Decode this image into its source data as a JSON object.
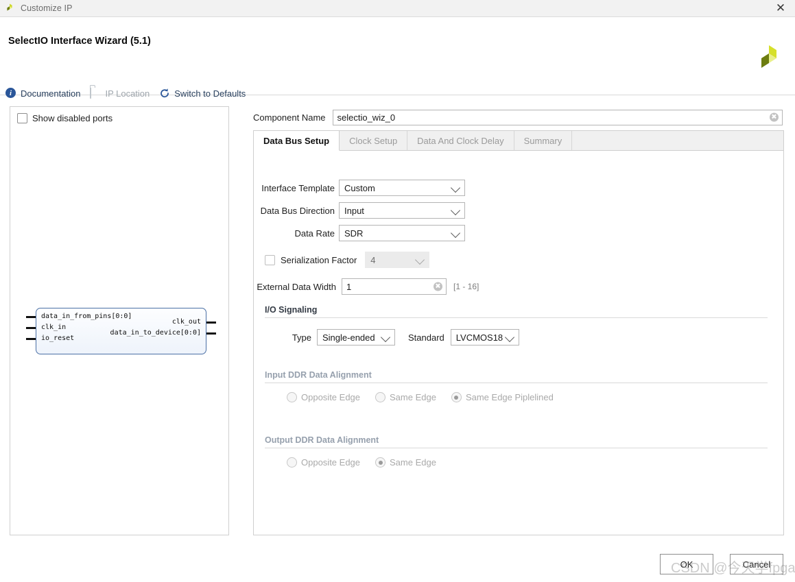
{
  "window": {
    "title": "Customize IP",
    "icon": "vivado-logo-icon",
    "close_label": "✕"
  },
  "header": {
    "wizard_title": "SelectIO Interface Wizard (5.1)",
    "logo": "xilinx-pinwheel-logo"
  },
  "toolbar": {
    "documentation": "Documentation",
    "ip_location": "IP Location",
    "switch_to_defaults": "Switch to Defaults"
  },
  "left_panel": {
    "show_disabled_ports": "Show disabled ports",
    "show_disabled_checked": false,
    "symbol": {
      "inputs": [
        "data_in_from_pins[0:0]",
        "clk_in",
        "io_reset"
      ],
      "outputs": [
        "clk_out",
        "data_in_to_device[0:0]"
      ]
    }
  },
  "component": {
    "label": "Component Name",
    "value": "selectio_wiz_0",
    "placeholder": "",
    "clear_glyph": "✖"
  },
  "tabs": [
    {
      "label": "Data Bus Setup",
      "active": true,
      "enabled": true
    },
    {
      "label": "Clock Setup",
      "active": false,
      "enabled": false
    },
    {
      "label": "Data And Clock Delay",
      "active": false,
      "enabled": false
    },
    {
      "label": "Summary",
      "active": false,
      "enabled": false
    }
  ],
  "form": {
    "interface_template": {
      "label": "Interface Template",
      "value": "Custom"
    },
    "data_bus_direction": {
      "label": "Data Bus Direction",
      "value": "Input"
    },
    "data_rate": {
      "label": "Data Rate",
      "value": "SDR"
    },
    "serialization_factor": {
      "label": "Serialization Factor",
      "value": "4",
      "checked": false,
      "enabled": false
    },
    "external_data_width": {
      "label": "External Data Width",
      "value": "1",
      "range_hint": "[1 - 16]",
      "clear_glyph": "✖"
    }
  },
  "io_signaling": {
    "title": "I/O Signaling",
    "type_label": "Type",
    "type_value": "Single-ended",
    "standard_label": "Standard",
    "standard_value": "LVCMOS18"
  },
  "input_ddr": {
    "title": "Input DDR Data Alignment",
    "options": [
      {
        "label": "Opposite Edge",
        "selected": false
      },
      {
        "label": "Same Edge",
        "selected": false
      },
      {
        "label": "Same Edge Piplelined",
        "selected": true
      }
    ]
  },
  "output_ddr": {
    "title": "Output DDR Data Alignment",
    "options": [
      {
        "label": "Opposite Edge",
        "selected": false
      },
      {
        "label": "Same Edge",
        "selected": true
      }
    ]
  },
  "footer": {
    "ok": "OK",
    "cancel": "Cancel"
  },
  "watermark": {
    "text": "CSDN @今天学fpga"
  }
}
